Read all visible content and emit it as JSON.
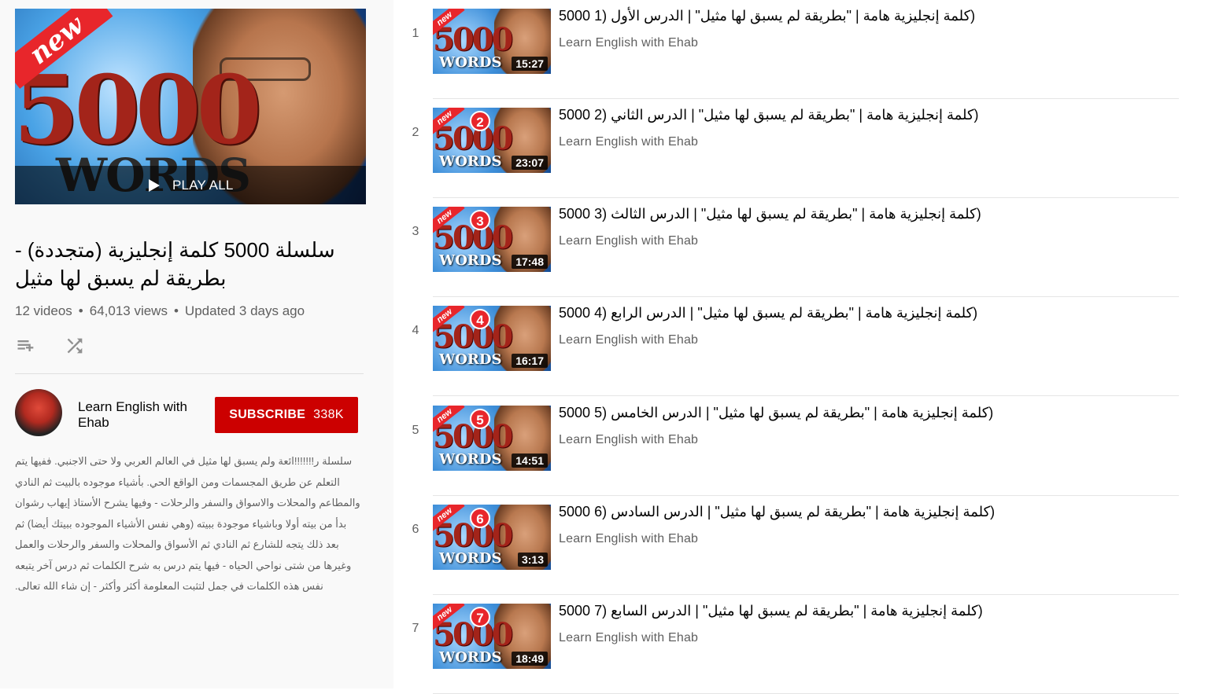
{
  "sidebar": {
    "hero": {
      "new_badge": "new",
      "number_text": "5000",
      "words_text": "WORDS",
      "play_all_label": "PLAY ALL"
    },
    "playlist_title": "سلسلة 5000 كلمة إنجليزية (متجددة) - بطريقة لم يسبق لها مثيل",
    "stats": {
      "videos": "12 videos",
      "views": "64,013 views",
      "updated": "Updated 3 days ago"
    },
    "owner": {
      "name": "Learn English with Ehab",
      "subscribe_label": "SUBSCRIBE",
      "subscriber_count": "338K"
    },
    "description": "سلسلة ر!!!!!!!ائعة ولم يسبق لها مثيل في العالم العربي ولا حتى الاجنبي. ففيها يتم التعلم عن طريق المجسمات ومن الواقع الحي. بأشياء موجوده بالبيت ثم النادي والمطاعم والمحلات والاسواق والسفر والرحلات - وفيها يشرح الأستاذ إيهاب رشوان بدأ من بيته أولا وباشياء موجودة ببيته (وهي نفس الأشياء الموجوده ببيتك أيضا) ثم بعد ذلك يتجه للشارع ثم النادي ثم الأسواق والمحلات والسفر والرحلات والعمل وغيرها من شتى نواحي الحياه - فيها يتم درس به شرح الكلمات ثم درس آخر يتبعه نفس هذه الكلمات في جمل لتثبت المعلومة أكثر وأكثر - إن شاء الله تعالى."
  },
  "videos": [
    {
      "index": "1",
      "title": "(كلمة إنجليزية هامة | \"بطريقة لم يسبق لها مثيل\" | الدرس الأول (1 5000",
      "channel": "Learn English with Ehab",
      "duration": "15:27",
      "badge_number": ""
    },
    {
      "index": "2",
      "title": "(كلمة إنجليزية هامة | \"بطريقة لم يسبق لها مثيل\" | الدرس الثاني (2 5000",
      "channel": "Learn English with Ehab",
      "duration": "23:07",
      "badge_number": "2"
    },
    {
      "index": "3",
      "title": "(كلمة إنجليزية هامة | \"بطريقة لم يسبق لها مثيل\" | الدرس الثالث (3 5000",
      "channel": "Learn English with Ehab",
      "duration": "17:48",
      "badge_number": "3"
    },
    {
      "index": "4",
      "title": "(كلمة إنجليزية هامة | \"بطريقة لم يسبق لها مثيل\" | الدرس الرابع (4 5000",
      "channel": "Learn English with Ehab",
      "duration": "16:17",
      "badge_number": "4"
    },
    {
      "index": "5",
      "title": "(كلمة إنجليزية هامة | \"بطريقة لم يسبق لها مثيل\" | الدرس الخامس (5 5000",
      "channel": "Learn English with Ehab",
      "duration": "14:51",
      "badge_number": "5"
    },
    {
      "index": "6",
      "title": "(كلمة إنجليزية هامة | \"بطريقة لم يسبق لها مثيل\" | الدرس السادس (6 5000",
      "channel": "Learn English with Ehab",
      "duration": "3:13",
      "badge_number": "6"
    },
    {
      "index": "7",
      "title": "(كلمة إنجليزية هامة | \"بطريقة لم يسبق لها مثيل\" | الدرس السابع (7 5000",
      "channel": "Learn English with Ehab",
      "duration": "18:49",
      "badge_number": "7"
    }
  ],
  "icons": {
    "add_to_queue": "playlist-add-icon",
    "shuffle": "shuffle-icon",
    "play": "play-icon"
  },
  "colors": {
    "subscribe": "#cc0000",
    "sidebar_bg": "#f9f9f9",
    "secondary_text": "#606060"
  }
}
